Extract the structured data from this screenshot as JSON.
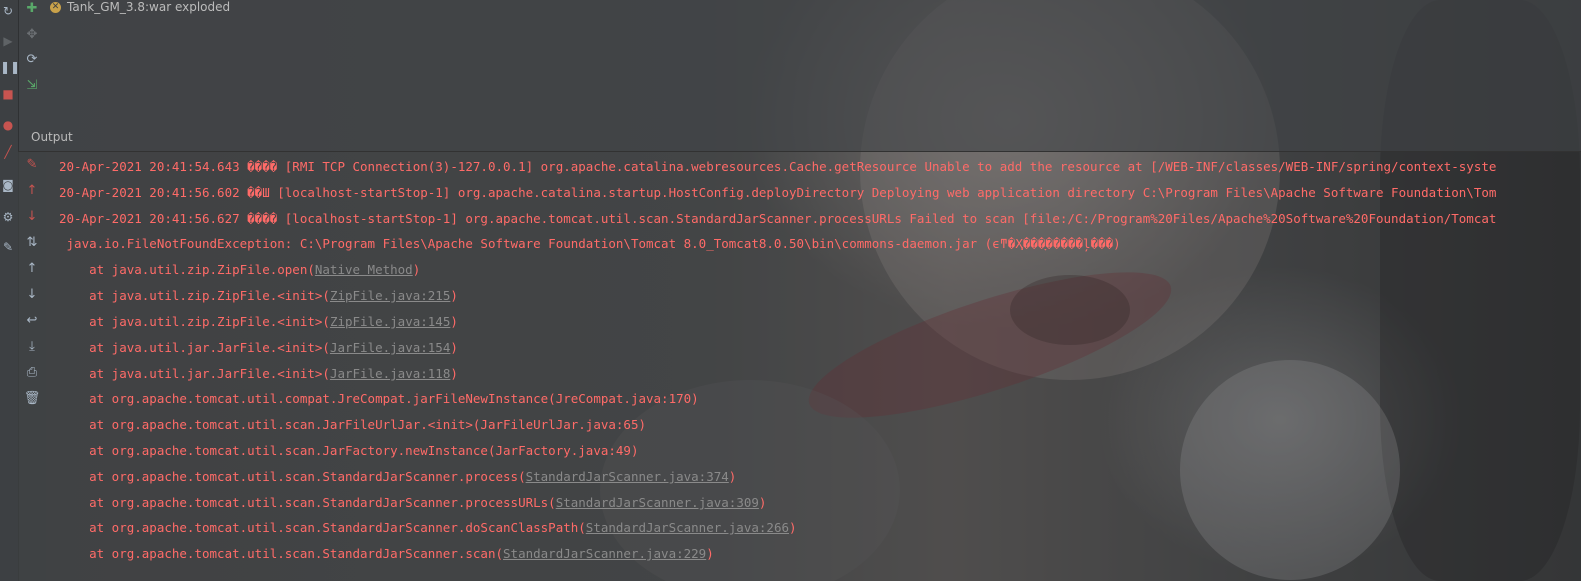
{
  "services": {
    "artifact_name": "Tank_GM_3.8:war exploded",
    "status_icon": "warning-icon"
  },
  "output_label": "Output",
  "colors": {
    "error_text": "#ff6b68",
    "link_text": "#8a8a8a",
    "panel_bg": "#3c3f41"
  },
  "left_toolbar_icons": [
    "refresh-icon",
    "run-icon",
    "pause-icon",
    "stop-icon",
    "debug-icon",
    "edit-icon",
    "camera-icon",
    "settings-icon",
    "pin-icon"
  ],
  "service_toolbar_icons": [
    "add-icon",
    "move-icon",
    "refresh-icon",
    "deploy-icon"
  ],
  "gutter_icons": [
    "clear-icon",
    "up-icon",
    "down-icon",
    "sort-icon",
    "scroll-up-icon",
    "scroll-down-icon",
    "soft-wrap-icon",
    "scroll-to-end-icon",
    "print-icon",
    "trash-icon"
  ],
  "console": {
    "lines": [
      {
        "text": "20-Apr-2021 20:41:54.643 ���� [RMI TCP Connection(3)-127.0.0.1] org.apache.catalina.webresources.Cache.getResource Unable to add the resource at [/WEB-INF/classes/WEB-INF/spring/context-syste"
      },
      {
        "text": "20-Apr-2021 20:41:56.602 ��Ш [localhost-startStop-1] org.apache.catalina.startup.HostConfig.deployDirectory Deploying web application directory C:\\Program Files\\Apache Software Foundation\\Tom"
      },
      {
        "text": "20-Apr-2021 20:41:56.627 ���� [localhost-startStop-1] org.apache.tomcat.util.scan.StandardJarScanner.processURLs Failed to scan [file:/C:/Program%20Files/Apache%20Software%20Foundation/Tomcat"
      },
      {
        "text": " java.io.FileNotFoundException: C:\\Program Files\\Apache Software Foundation\\Tomcat 8.0_Tomcat8.0.50\\bin\\commons-daemon.jar (ϵͳ�Ҳ���ָ�����ļ���)"
      },
      {
        "prefix": "    at java.util.zip.ZipFile.open(",
        "link": "Native Method",
        "suffix": ")"
      },
      {
        "prefix": "    at java.util.zip.ZipFile.<init>(",
        "link": "ZipFile.java:215",
        "suffix": ")"
      },
      {
        "prefix": "    at java.util.zip.ZipFile.<init>(",
        "link": "ZipFile.java:145",
        "suffix": ")"
      },
      {
        "prefix": "    at java.util.jar.JarFile.<init>(",
        "link": "JarFile.java:154",
        "suffix": ")"
      },
      {
        "prefix": "    at java.util.jar.JarFile.<init>(",
        "link": "JarFile.java:118",
        "suffix": ")"
      },
      {
        "text": "    at org.apache.tomcat.util.compat.JreCompat.jarFileNewInstance(JreCompat.java:170)"
      },
      {
        "text": "    at org.apache.tomcat.util.scan.JarFileUrlJar.<init>(JarFileUrlJar.java:65)"
      },
      {
        "text": "    at org.apache.tomcat.util.scan.JarFactory.newInstance(JarFactory.java:49)"
      },
      {
        "prefix": "    at org.apache.tomcat.util.scan.StandardJarScanner.process(",
        "link": "StandardJarScanner.java:374",
        "suffix": ")"
      },
      {
        "prefix": "    at org.apache.tomcat.util.scan.StandardJarScanner.processURLs(",
        "link": "StandardJarScanner.java:309",
        "suffix": ")"
      },
      {
        "prefix": "    at org.apache.tomcat.util.scan.StandardJarScanner.doScanClassPath(",
        "link": "StandardJarScanner.java:266",
        "suffix": ")"
      },
      {
        "prefix": "    at org.apache.tomcat.util.scan.StandardJarScanner.scan(",
        "link": "StandardJarScanner.java:229",
        "suffix": ")"
      }
    ]
  }
}
